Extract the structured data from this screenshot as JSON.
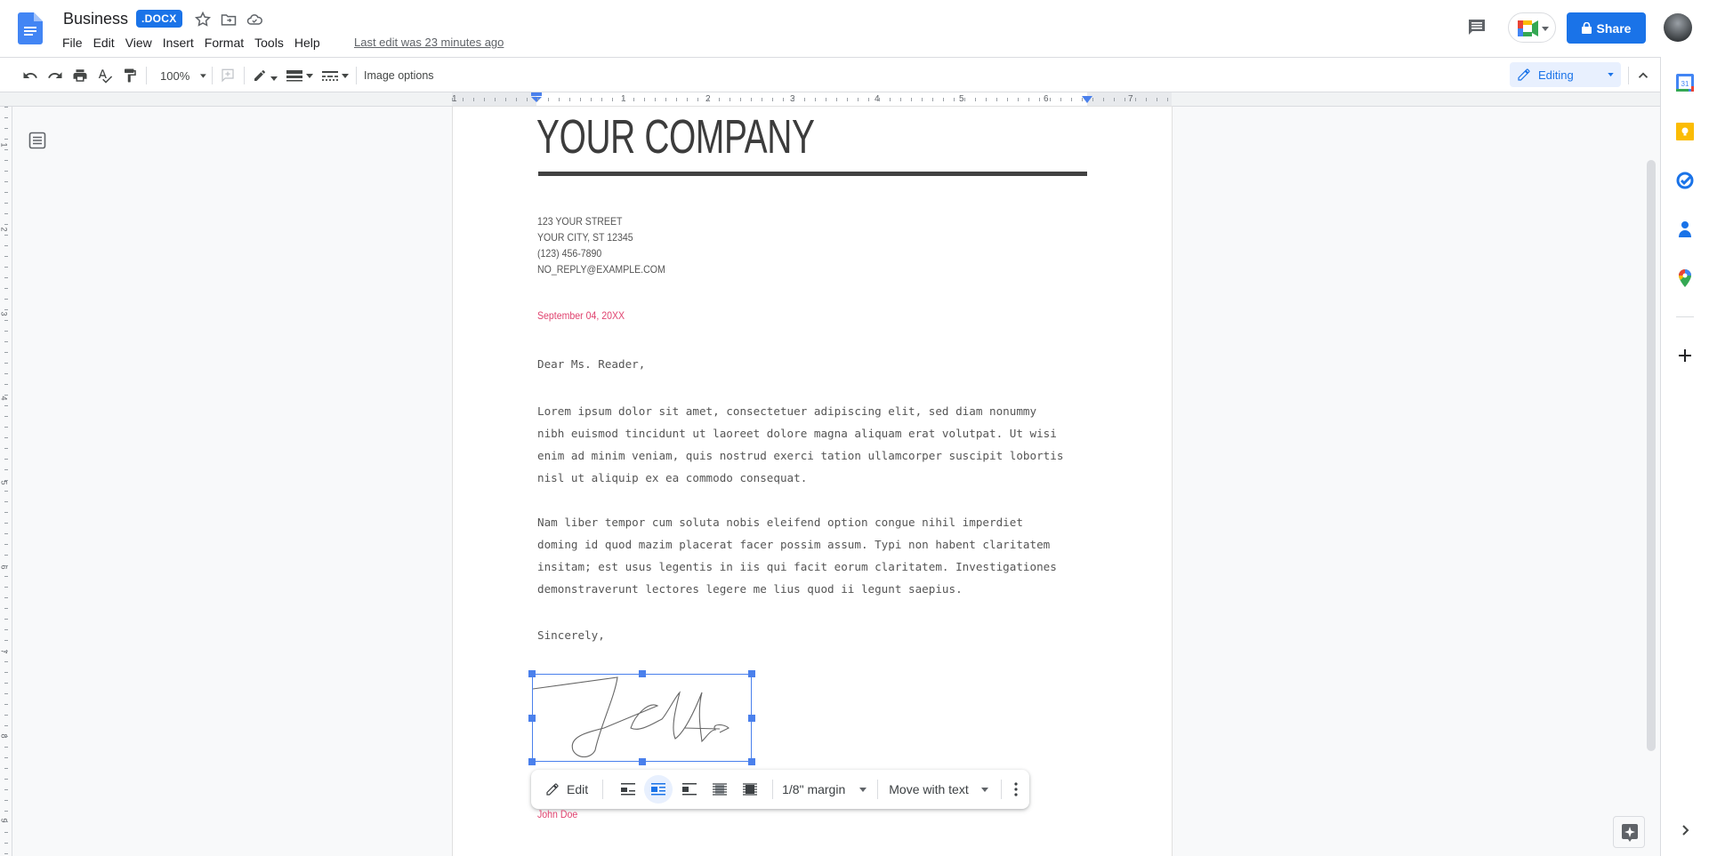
{
  "header": {
    "title": "Business",
    "badge": ".DOCX",
    "last_edit": "Last edit was 23 minutes ago",
    "share_label": "Share",
    "menu": [
      "File",
      "Edit",
      "View",
      "Insert",
      "Format",
      "Tools",
      "Help"
    ]
  },
  "toolbar": {
    "zoom": "100%",
    "image_options": "Image options",
    "mode": "Editing"
  },
  "ruler": {
    "h_labels": [
      "1",
      "1",
      "2",
      "3",
      "4",
      "5",
      "6",
      "7"
    ],
    "v_labels": [
      "1",
      "2",
      "3",
      "4",
      "5",
      "6",
      "7",
      "8",
      "9"
    ]
  },
  "document": {
    "company": "YOUR COMPANY",
    "address": [
      "123 YOUR STREET",
      "YOUR CITY, ST 12345",
      "(123) 456-7890",
      "NO_REPLY@EXAMPLE.COM"
    ],
    "date": "September 04, 20XX",
    "salutation": "Dear Ms. Reader,",
    "paragraph1": [
      "Lorem ipsum dolor sit amet, consectetuer adipiscing elit, sed diam nonummy",
      "nibh euismod tincidunt ut laoreet dolore magna aliquam erat volutpat. Ut wisi",
      "enim ad minim veniam, quis nostrud exerci tation ullamcorper suscipit lobortis",
      "nisl ut aliquip ex ea commodo consequat."
    ],
    "paragraph2": [
      "Nam liber tempor cum soluta nobis eleifend option congue nihil imperdiet",
      "doming id quod mazim placerat facer possim assum. Typi non habent claritatem",
      "insitam; est usus legentis in iis qui facit eorum claritatem. Investigationes",
      "demonstraverunt lectores legere me lius quod ii legunt saepius."
    ],
    "closing": "Sincerely,",
    "signature_name": "John Doe"
  },
  "image_toolbar": {
    "edit_label": "Edit",
    "margin": "1/8\" margin",
    "position": "Move with text",
    "selected_wrap": "wrap-text"
  },
  "colors": {
    "accent": "#1a73e8",
    "date_pink": "#e0436f",
    "selection": "#4a80ec"
  }
}
